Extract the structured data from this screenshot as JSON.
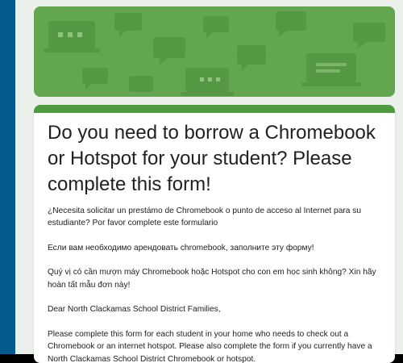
{
  "colors": {
    "side_strip": "#04598e",
    "page_background": "#ecf0ea",
    "banner_green": "#62a64f",
    "card_accent": "#4f9a3f",
    "text": "#202124"
  },
  "banner": {
    "pattern_icons": [
      "chat-bubble-icon",
      "chromebook-laptop-icon"
    ]
  },
  "form": {
    "title": "Do you need to borrow a Chromebook or Hotspot for your student? Please complete this form!",
    "description": {
      "spanish": "¿Necesita solicitar un prestámo de Chromebook o punto de acceso al Internet para su estudiante?  Por favor complete este formulario",
      "russian": "Если вам необходимо арендовать chromebook, заполните эту форму!",
      "vietnamese": "Quý vị có cần mượn máy Chromebook hoặc Hotspot cho con em học sinh không? Xin hãy hoàn tất mẫu đơn này!",
      "greeting": "Dear North Clackamas School District Families,",
      "instructions": "Please complete this form for each student in your home who needs to check out a Chromebook or an internet hotspot. Please also complete the form if you currently have a North Clackamas School District Chromebook or hotspot."
    }
  }
}
